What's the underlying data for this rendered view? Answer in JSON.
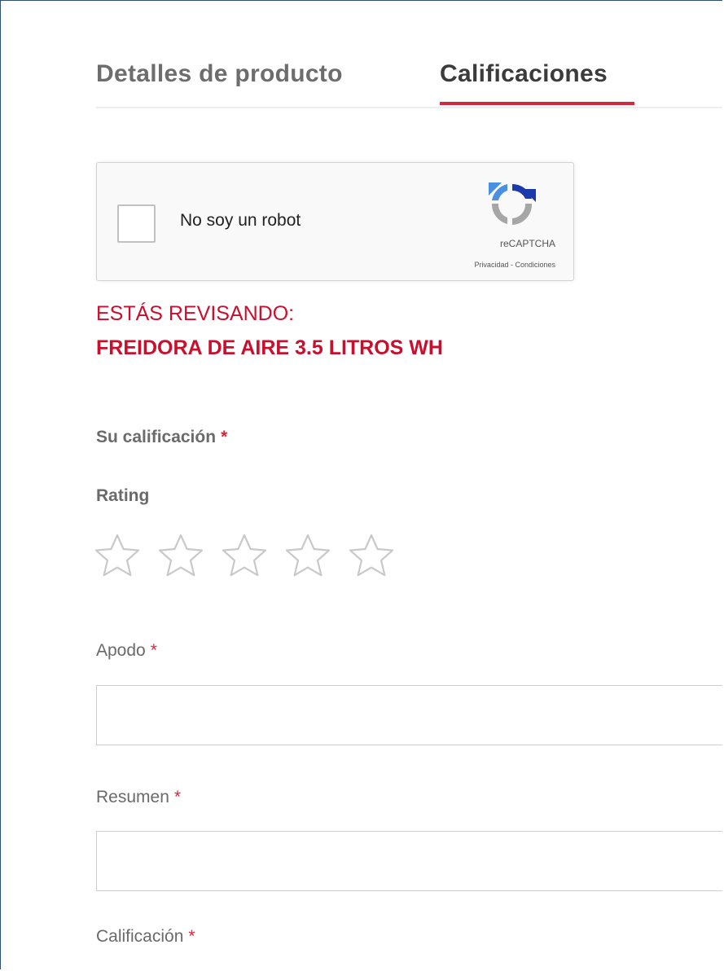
{
  "tabs": [
    {
      "label": "Detalles de producto",
      "active": false
    },
    {
      "label": "Calificaciones",
      "active": true
    }
  ],
  "recaptcha": {
    "label": "No soy un robot",
    "brand": "reCAPTCHA",
    "privacy": "Privacidad",
    "separator": " - ",
    "terms": "Condiciones",
    "checked": false
  },
  "review": {
    "reviewing_label": "ESTÁS REVISANDO:",
    "product_name": "FREIDORA DE AIRE 3.5 LITROS WH"
  },
  "form": {
    "rating_section_label": "Su calificación",
    "rating_label": "Rating",
    "rating_value": 0,
    "rating_max": 5,
    "nickname_label": "Apodo",
    "nickname_value": "",
    "summary_label": "Resumen",
    "summary_value": "",
    "review_label": "Calificación",
    "required_marker": "*"
  },
  "colors": {
    "accent": "#d4283d",
    "product_text": "#c8102e",
    "star_outline": "#c9c9c9"
  }
}
